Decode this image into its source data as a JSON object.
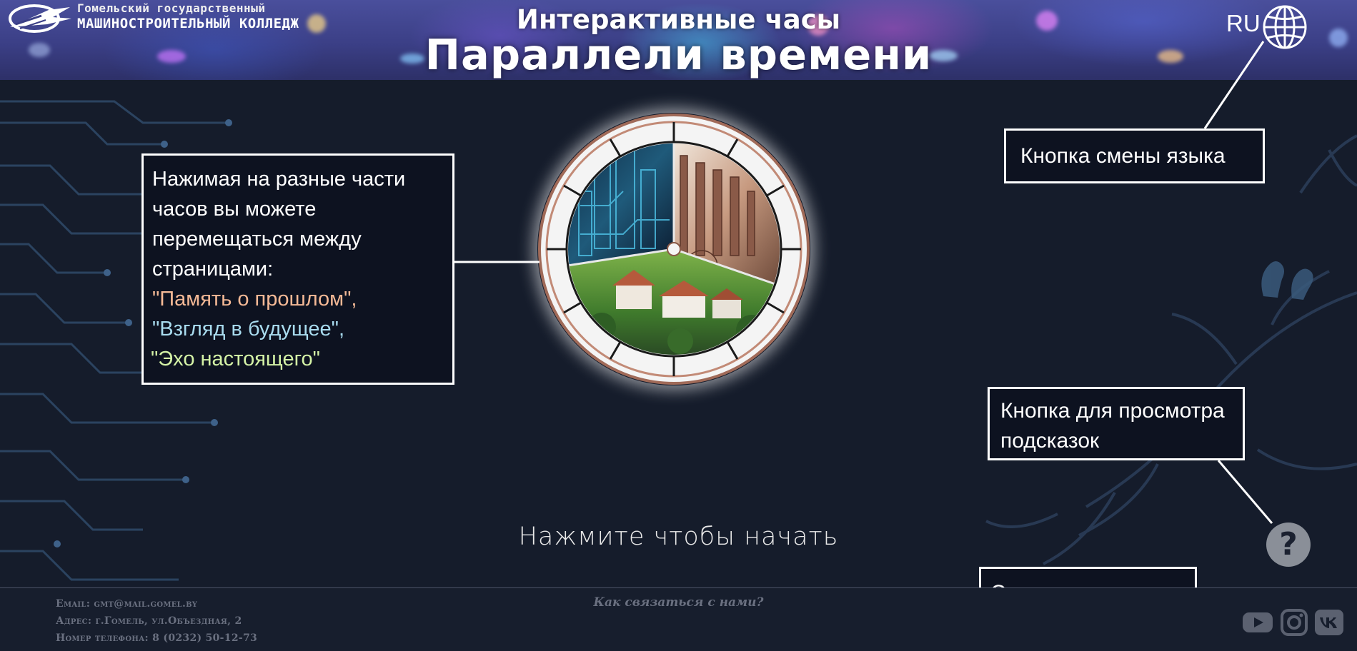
{
  "header": {
    "college_line1": "Гомельский государственный",
    "college_line2": "МАШИНОСТРОИТЕЛЬНЫЙ КОЛЛЕДЖ",
    "subtitle": "Интерактивные часы",
    "title": "Параллели времени",
    "language_code": "RU"
  },
  "callouts": {
    "clock_intro": "Нажимая на разные части часов вы можете перемещаться между страницами:",
    "page_past": "\"Память о прошлом\",",
    "page_future": "\"Взгляд в будущее\",",
    "page_present": "\"Эхо настоящего\"",
    "language_button": "Кнопка смены языка",
    "help_button": "Кнопка для просмотра подсказок",
    "social": "Социальные сети"
  },
  "main": {
    "start_prompt": "Нажмите чтобы начать",
    "help_symbol": "?"
  },
  "footer": {
    "email": "Email: gmt@mail.gomel.by",
    "address": "Адрес: г.Гомель, ул.Объездная, 2",
    "phone": "Номер телефона: 8 (0232) 50-12-73",
    "contact_title": "Как связаться с нами?"
  },
  "icons": {
    "logo": "college-logo-icon",
    "globe": "globe-icon",
    "youtube": "youtube-icon",
    "instagram": "instagram-icon",
    "vk": "vk-icon"
  },
  "colors": {
    "background": "#151c2b",
    "past_text": "#f4b996",
    "future_text": "#a9dcef",
    "present_text": "#d4f2a6",
    "footer_text": "#6a7080"
  }
}
